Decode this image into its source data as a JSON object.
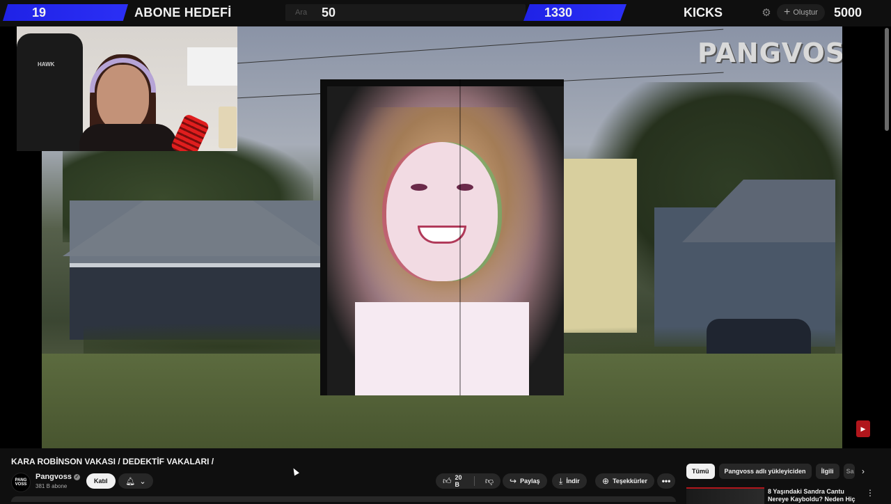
{
  "overlay": {
    "left_goal_count": "19",
    "left_goal_label": "ABONE HEDEFİ",
    "search_hint": "Ara",
    "middle_count": "50",
    "right_goal_count": "1330",
    "right_goal_label": "KICKS",
    "create_label": "Oluştur",
    "end_goal_count": "5000",
    "accent_color": "#2b2ff5"
  },
  "video": {
    "watermark": "PANGVOSS",
    "webcam_chair_logo": "HAWK"
  },
  "meta": {
    "title": "KARA ROBİNSON VAKASI / DEDEKTİF VAKALARI /",
    "channel": {
      "avatar_text": "PANG VOSS",
      "name": "Pangvoss",
      "subscribers": "381 B abone",
      "join_label": "Katıl"
    },
    "actions": {
      "like_count": "20 B",
      "share_label": "Paylaş",
      "download_label": "İndir",
      "thanks_label": "Teşekkürler"
    }
  },
  "sidebar": {
    "chips": [
      "Tümü",
      "Pangvoss adlı yükleyiciden",
      "İlgili",
      "Sa"
    ],
    "recommendation": {
      "title": "8 Yaşındaki Sandra Cantu Nereye Kayboldu? Neden Hiç"
    }
  },
  "icons": {
    "settings": "gear-icon",
    "create": "plus-icon",
    "bell": "bell-icon",
    "like": "thumbs-up-icon",
    "dislike": "thumbs-down-icon",
    "share": "share-icon",
    "download": "download-icon",
    "thanks": "thanks-icon",
    "more": "more-icon",
    "next": "chevron-right-icon"
  }
}
